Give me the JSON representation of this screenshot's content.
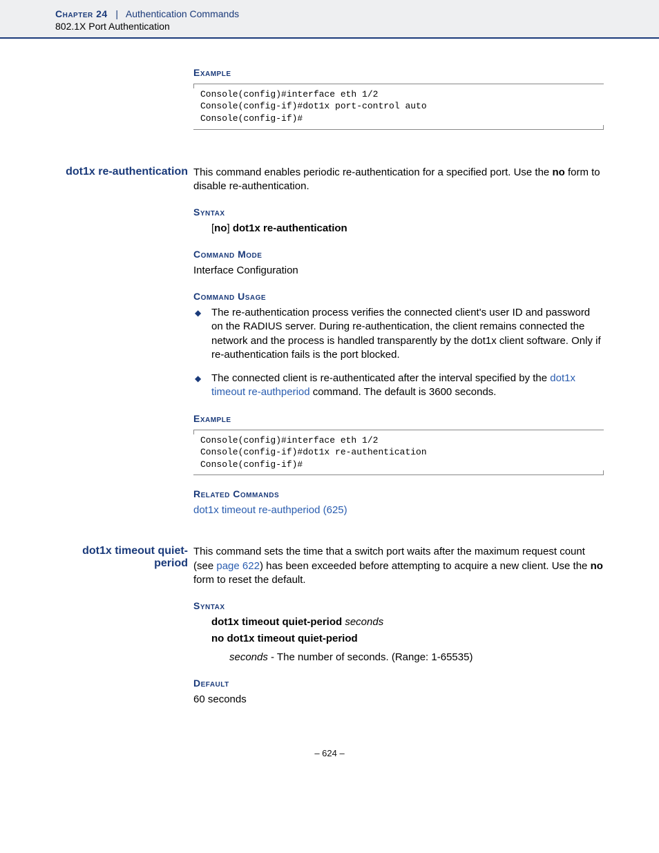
{
  "header": {
    "chapter": "Chapter 24",
    "sep": "|",
    "section": "Authentication Commands",
    "sub": "802.1X Port Authentication"
  },
  "block1": {
    "label_example": "Example",
    "code": "Console(config)#interface eth 1/2\nConsole(config-if)#dot1x port-control auto\nConsole(config-if)#"
  },
  "block2": {
    "margin": "dot1x re-authentication",
    "intro_a": "This command enables periodic re-authentication for a specified port. Use the ",
    "intro_bold": "no",
    "intro_b": " form to disable re-authentication.",
    "label_syntax": "Syntax",
    "syntax_br1": "[",
    "syntax_no": "no",
    "syntax_br2": "] ",
    "syntax_cmd": "dot1x re-authentication",
    "label_mode": "Command Mode",
    "mode": "Interface Configuration",
    "label_usage": "Command Usage",
    "usage1": "The re-authentication process verifies the connected client's user ID and password on the RADIUS server. During re-authentication, the client remains connected the network and the process is handled transparently by the dot1x client software. Only if re-authentication fails is the port blocked.",
    "usage2a": "The connected client is re-authenticated after the interval specified by the ",
    "usage2link": "dot1x timeout re-authperiod",
    "usage2b": " command. The default is 3600 seconds.",
    "label_example": "Example",
    "code": "Console(config)#interface eth 1/2\nConsole(config-if)#dot1x re-authentication\nConsole(config-if)#",
    "label_related": "Related Commands",
    "related": "dot1x timeout re-authperiod (625)"
  },
  "block3": {
    "margin": "dot1x timeout quiet-period",
    "intro_a": "This command sets the time that a switch port waits after the maximum request count (see ",
    "intro_link": "page 622",
    "intro_b": ") has been exceeded before attempting to acquire a new client. Use the ",
    "intro_bold": "no",
    "intro_c": " form to reset the default.",
    "label_syntax": "Syntax",
    "syntax1_cmd": "dot1x timeout quiet-period",
    "syntax1_arg": "seconds",
    "syntax2": "no dot1x timeout quiet-period",
    "param_arg": "seconds",
    "param_desc": " - The number of seconds. (Range: 1-65535)",
    "label_default": "Default",
    "default": "60 seconds"
  },
  "footer": "–  624  –"
}
